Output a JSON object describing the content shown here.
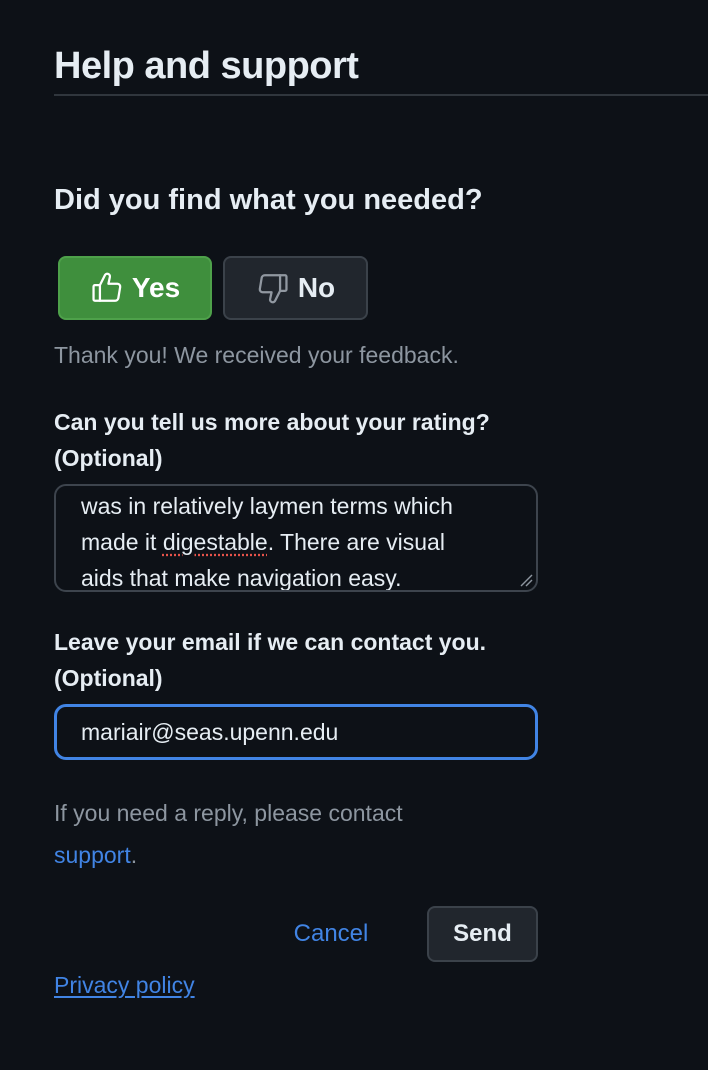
{
  "header": {
    "title": "Help and support"
  },
  "feedback": {
    "question": "Did you find what you needed?",
    "yes_label": "Yes",
    "no_label": "No",
    "selected": "Yes",
    "thanks_message": "Thank you! We received your feedback."
  },
  "rating_details": {
    "label_line1": "Can you tell us more about your rating?",
    "label_line2": "(Optional)",
    "text_line1": "was in relatively laymen terms which",
    "text_line2_before": "made it ",
    "text_line2_misspelled": "digestable",
    "text_line2_after": ". There are visual",
    "text_line3": "aids that make navigation easy."
  },
  "email": {
    "label_line1": "Leave your email if we can contact you.",
    "label_line2": "(Optional)",
    "value": "mariair@seas.upenn.edu"
  },
  "help": {
    "text_before": "If you need a reply, please contact",
    "link_text": "support",
    "text_after": "."
  },
  "actions": {
    "cancel_label": "Cancel",
    "send_label": "Send"
  },
  "footer": {
    "privacy_label": "Privacy policy"
  },
  "icons": {
    "yes": "thumbs-up-icon",
    "no": "thumbs-down-icon"
  },
  "colors": {
    "background": "#0d1117",
    "yes_button": "#3f8f3d",
    "secondary_button": "#21262d",
    "link": "#4184e4",
    "focus_border": "#4184e4",
    "muted_text": "#8d96a0"
  }
}
